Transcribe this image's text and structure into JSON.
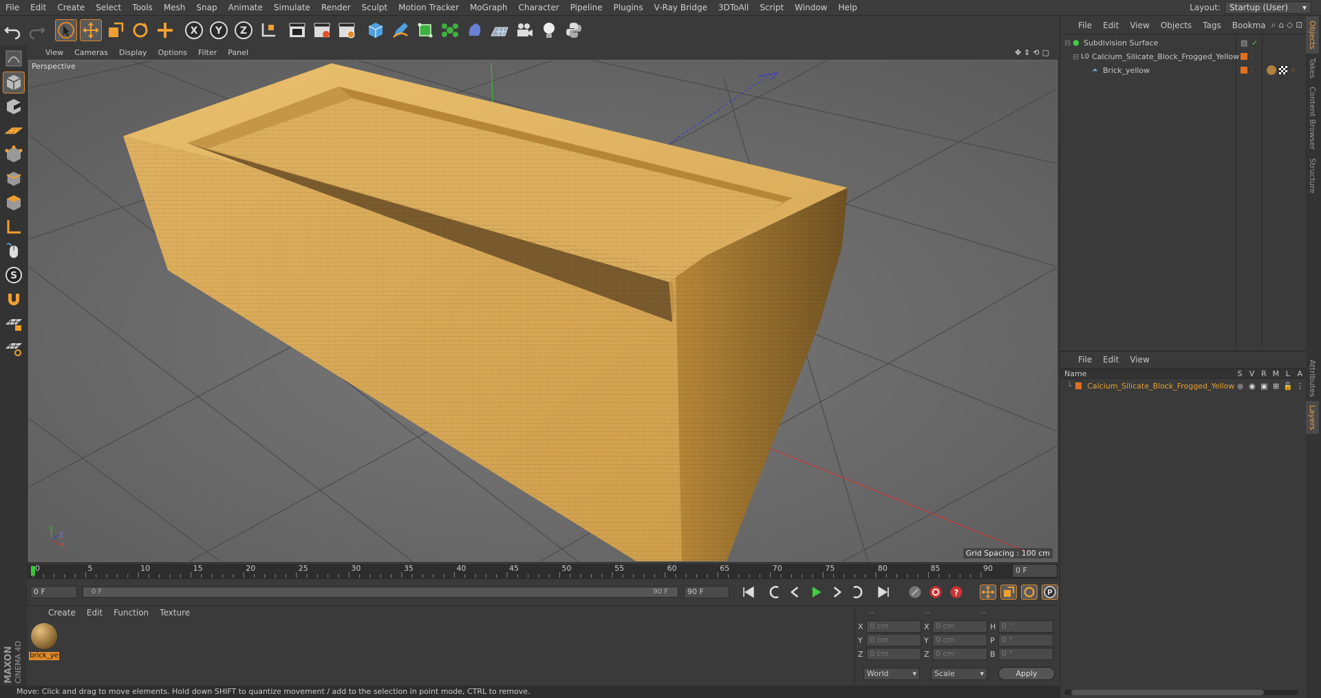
{
  "menubar": {
    "items": [
      "File",
      "Edit",
      "Create",
      "Select",
      "Tools",
      "Mesh",
      "Snap",
      "Animate",
      "Simulate",
      "Render",
      "Sculpt",
      "Motion Tracker",
      "MoGraph",
      "Character",
      "Pipeline",
      "Plugins",
      "V-Ray Bridge",
      "3DToAll",
      "Script",
      "Window",
      "Help"
    ],
    "layout_label": "Layout:",
    "layout_value": "Startup (User)"
  },
  "toolbar": {
    "icons": [
      "undo-icon",
      "redo-icon",
      "select-arrow-icon",
      "move-icon",
      "scale-icon",
      "rotate-icon",
      "add-transform-icon",
      "x-axis-icon",
      "y-axis-icon",
      "z-axis-icon",
      "coordinate-system-icon",
      "render-view-icon",
      "render-picture-viewer-icon",
      "edit-render-settings-icon",
      "cube-icon",
      "pen-icon",
      "subdivision-icon",
      "cloner-icon",
      "deformer-icon",
      "floor-icon",
      "camera-icon",
      "light-icon",
      "python-icon"
    ],
    "axis_x": "X",
    "axis_y": "Y",
    "axis_z": "Z"
  },
  "viewport": {
    "menu": [
      "View",
      "Cameras",
      "Display",
      "Options",
      "Filter",
      "Panel"
    ],
    "label": "Perspective",
    "grid_spacing": "Grid Spacing : 100 cm",
    "axis_labels": {
      "y": "Y",
      "z": "Z",
      "x": "X"
    }
  },
  "timeline": {
    "ticks": [
      "0",
      "5",
      "10",
      "15",
      "20",
      "25",
      "30",
      "35",
      "40",
      "45",
      "50",
      "55",
      "60",
      "65",
      "70",
      "75",
      "80",
      "85",
      "90"
    ],
    "current_frame": "0 F"
  },
  "transport": {
    "start": "0 F",
    "slider_start": "0 F",
    "slider_end": "90 F",
    "end": "90 F"
  },
  "material_manager": {
    "menu": [
      "Create",
      "Edit",
      "Function",
      "Texture"
    ],
    "material_name": "brick_ye"
  },
  "coordinates": {
    "headers": [
      "--",
      "--",
      "--"
    ],
    "rows": [
      {
        "a": "X",
        "av": "0 cm",
        "b": "X",
        "bv": "0 cm",
        "c": "H",
        "cv": "0 °"
      },
      {
        "a": "Y",
        "av": "0 cm",
        "b": "Y",
        "bv": "0 cm",
        "c": "P",
        "cv": "0 °"
      },
      {
        "a": "Z",
        "av": "0 cm",
        "b": "Z",
        "bv": "0 cm",
        "c": "B",
        "cv": "0 °"
      }
    ],
    "mode1": "World",
    "mode2": "Scale",
    "apply": "Apply"
  },
  "object_manager": {
    "menu": [
      "File",
      "Edit",
      "View",
      "Objects",
      "Tags",
      "Bookma"
    ],
    "objects": [
      {
        "name": "Subdivision Surface"
      },
      {
        "name": "Calcium_Silicate_Block_Frogged_Yellow"
      },
      {
        "name": "Brick_yellow"
      }
    ]
  },
  "layer_manager": {
    "menu": [
      "File",
      "Edit",
      "View"
    ],
    "headers": {
      "name": "Name",
      "s": "S",
      "v": "V",
      "r": "R",
      "m": "M",
      "l": "L",
      "a": "A"
    },
    "layer_name": "Calcium_Silicate_Block_Frogged_Yellow"
  },
  "right_tabs": [
    "Objects",
    "Takes",
    "Content Browser",
    "Structure",
    "Attributes",
    "Layers"
  ],
  "brand": {
    "line1": "MAXON",
    "line2": "CINEMA 4D"
  },
  "statusbar": "Move: Click and drag to move elements. Hold down SHIFT to quantize movement / add to the selection in point mode, CTRL to remove.",
  "colors": {
    "accent": "#e08a2b",
    "brick": "#d8a858",
    "layer_text": "#e8a030"
  }
}
